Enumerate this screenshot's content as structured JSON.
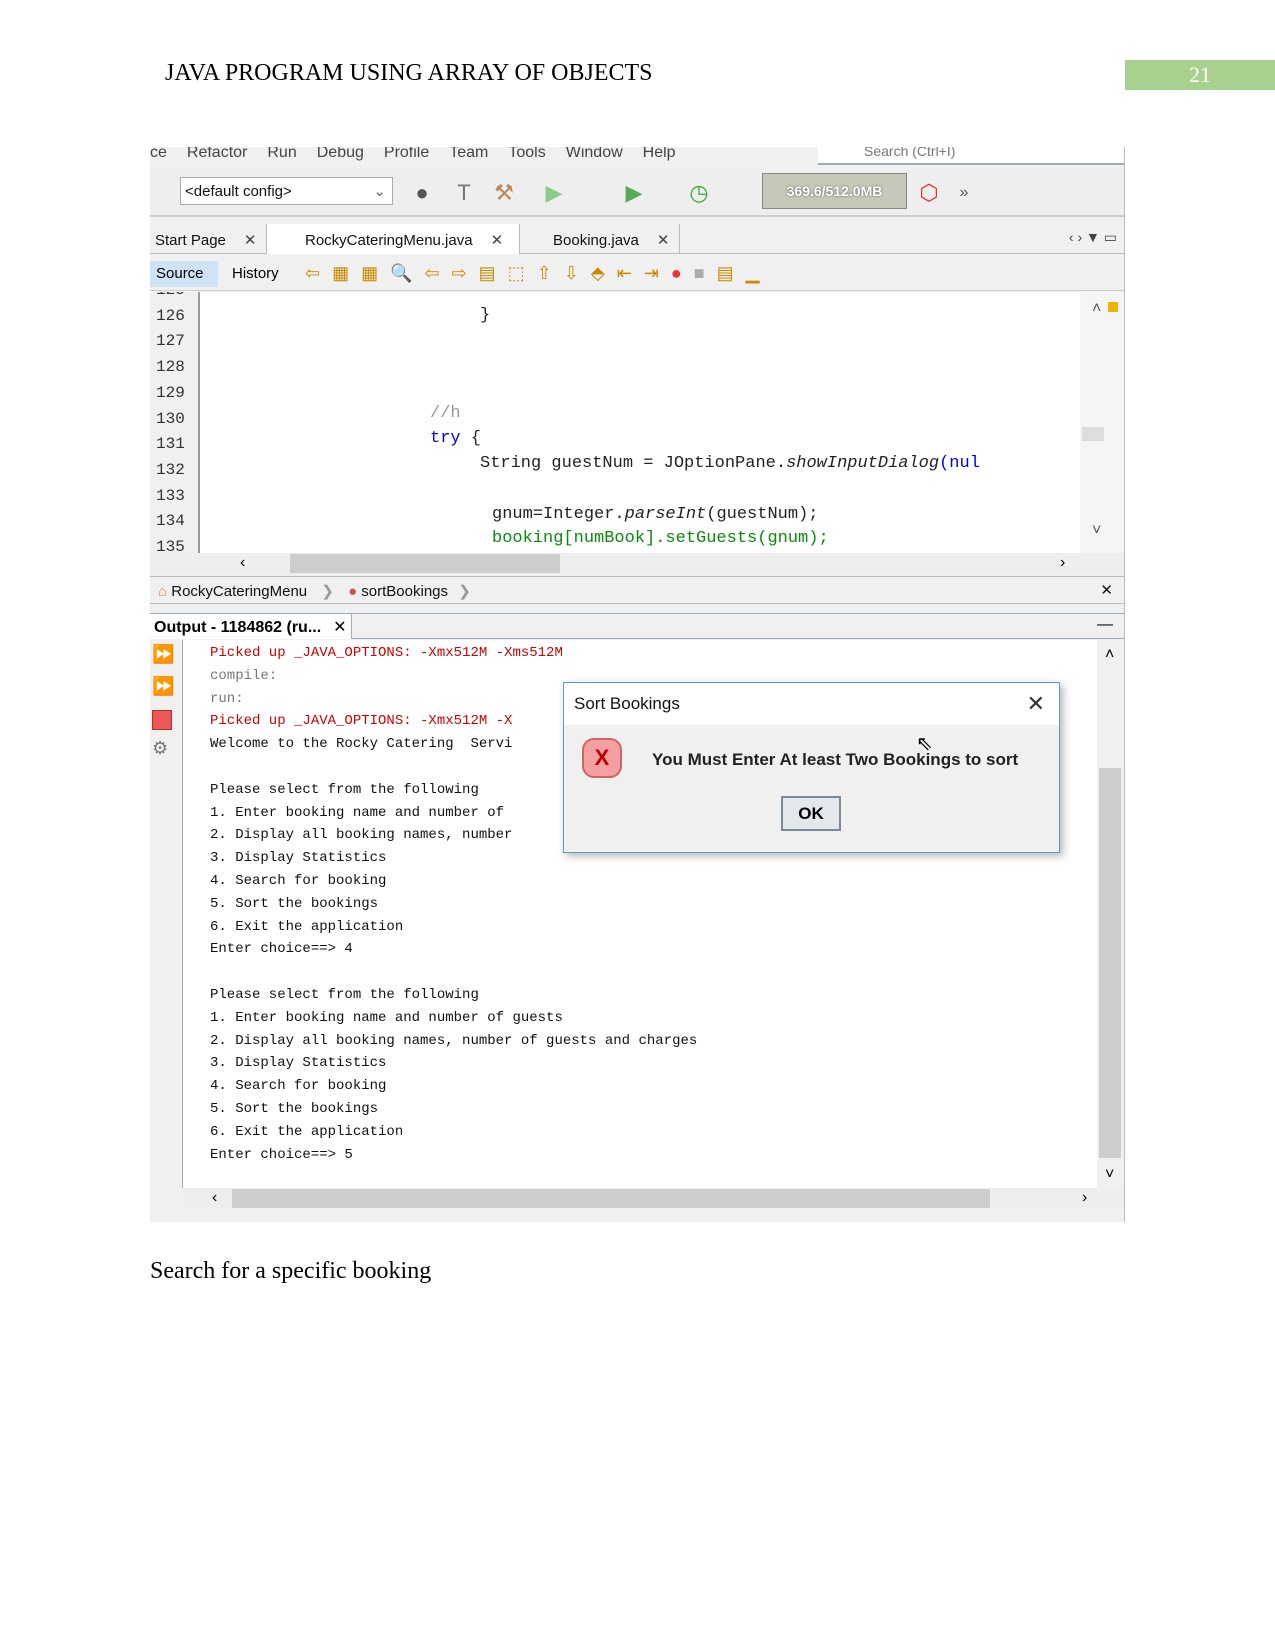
{
  "document": {
    "title": "JAVA PROGRAM USING ARRAY OF OBJECTS",
    "page_number": "21",
    "caption": "Search for  a specific booking"
  },
  "ide": {
    "menu": [
      "ce",
      "Refactor",
      "Run",
      "Debug",
      "Profile",
      "Team",
      "Tools",
      "Window",
      "Help"
    ],
    "search_placeholder": "Search (Ctrl+I)",
    "config": "<default config>",
    "memory": "369.6/512.0MB",
    "tabs": [
      {
        "label": "Start Page"
      },
      {
        "label": "RockyCateringMenu.java"
      },
      {
        "label": "Booking.java"
      }
    ],
    "source_label": "Source",
    "history_label": "History",
    "line_numbers": [
      "125",
      "126",
      "127",
      "128",
      "129",
      "130",
      "131",
      "132",
      "133",
      "134",
      "135"
    ],
    "code": {
      "l126": "}",
      "l130": "//h",
      "l131_kw": "try",
      "l131_rest": " {",
      "l132a": "String guestNum = JOptionPane.",
      "l132b": "showInputDialog",
      "l132c": "(nul",
      "l134a": "gnum=Integer.",
      "l134b": "parseInt",
      "l134c": "(guestNum);",
      "l135": "booking[numBook].setGuests(gnum);"
    },
    "breadcrumb": [
      "RockyCateringMenu",
      "sortBookings"
    ],
    "output_tab": "Output - 1184862 (ru...",
    "output_lines": [
      {
        "t": "Picked up _JAVA_OPTIONS: -Xmx512M -Xms512M",
        "c": "red"
      },
      {
        "t": "compile:",
        "c": "grey"
      },
      {
        "t": "run:",
        "c": "grey"
      },
      {
        "t": "Picked up _JAVA_OPTIONS: -Xmx512M -X",
        "c": "red"
      },
      {
        "t": "Welcome to the Rocky Catering  Servi",
        "c": ""
      },
      {
        "t": "",
        "c": ""
      },
      {
        "t": "Please select from the following",
        "c": ""
      },
      {
        "t": "1. Enter booking name and number of",
        "c": ""
      },
      {
        "t": "2. Display all booking names, number",
        "c": ""
      },
      {
        "t": "3. Display Statistics",
        "c": ""
      },
      {
        "t": "4. Search for booking",
        "c": ""
      },
      {
        "t": "5. Sort the bookings",
        "c": ""
      },
      {
        "t": "6. Exit the application",
        "c": ""
      },
      {
        "t": "Enter choice==> 4",
        "c": ""
      },
      {
        "t": "",
        "c": ""
      },
      {
        "t": "Please select from the following",
        "c": ""
      },
      {
        "t": "1. Enter booking name and number of guests",
        "c": ""
      },
      {
        "t": "2. Display all booking names, number of guests and charges",
        "c": ""
      },
      {
        "t": "3. Display Statistics",
        "c": ""
      },
      {
        "t": "4. Search for booking",
        "c": ""
      },
      {
        "t": "5. Sort the bookings",
        "c": ""
      },
      {
        "t": "6. Exit the application",
        "c": ""
      },
      {
        "t": "Enter choice==> 5",
        "c": ""
      }
    ],
    "dialog": {
      "title": "Sort Bookings",
      "message": "You Must Enter At least Two Bookings to sort",
      "ok": "OK",
      "icon": "error-x-icon"
    }
  }
}
